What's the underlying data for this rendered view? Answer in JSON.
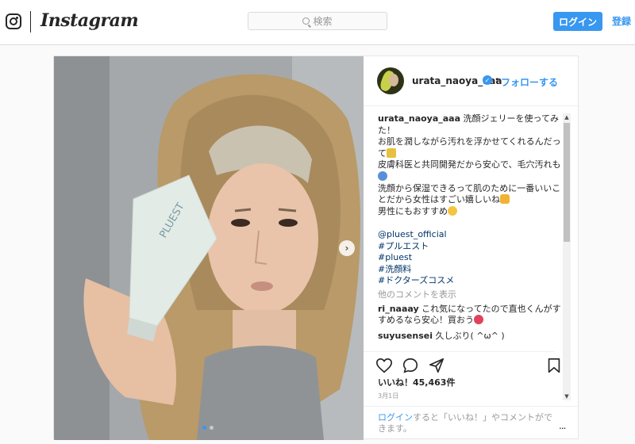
{
  "nav": {
    "wordmark": "Instagram",
    "search_placeholder": "検索",
    "login_label": "ログイン",
    "signup_label": "登録"
  },
  "post": {
    "username": "urata_naoya_aaa",
    "verified": "✓",
    "bullet": "•",
    "follow_label": "フォローする",
    "carousel": {
      "total": 2,
      "current": 1
    },
    "caption": {
      "username": "urata_naoya_aaa",
      "lines": [
        "洗顔ジェリーを使ってみた！",
        "お肌を潤しながら汚れを浮かせてくれるんだって",
        "皮膚科医と共同開発だから安心で、毛穴汚れも",
        "洗顔から保湿できるって肌のために一番いいことだから女性はすごい嬉しいね",
        "男性にもおすすめ"
      ],
      "tags": [
        "@pluest_official",
        "#プルエスト",
        "#pluest",
        "#洗顔料",
        "#ドクターズコスメ"
      ]
    },
    "more_comments": "他のコメントを表示",
    "comments": [
      {
        "user": "ri_naaay",
        "text": "これ気になってたので直也くんがすすめるなら安心！買おう"
      },
      {
        "user": "suyusensei",
        "text": "久しぶり( ^ω^ )"
      }
    ],
    "likes_label": "いいね！45,463件",
    "date": "3月1日",
    "login_prompt": {
      "link": "ログイン",
      "text": "すると「いいね！」やコメントができます。"
    },
    "options_icon": "..."
  },
  "photo": {
    "product_label": "PLUEST",
    "description_colors": {
      "towel": "#b99a68",
      "background": "#9ea3a7",
      "tube": "#e3ebe6",
      "skin": "#e9c4aa"
    }
  },
  "icons": [
    "instagram-logo-icon",
    "search-icon",
    "verified-icon",
    "heart-icon",
    "comment-icon",
    "share-icon",
    "bookmark-icon",
    "chevron-right-icon"
  ]
}
